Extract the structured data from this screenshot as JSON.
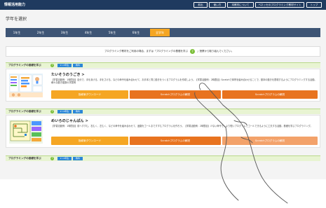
{
  "header": {
    "title": "情報活用能力",
    "buttons": [
      "前出",
      "使い方",
      "本教材について",
      "ベネッセのプログラミング教材サイト",
      "トップ"
    ]
  },
  "section_title": "学年を選択",
  "grades": [
    "1年生",
    "2年生",
    "3年生",
    "4年生",
    "5年生",
    "6年生",
    "全学年"
  ],
  "notice": {
    "text": "プログラミング教材をご利用の場合、まずは「プログラミングの基礎を学ぶ",
    "badge": "?",
    "text_after": "」授業から取り組んでください。"
  },
  "section_label": "プログラミングの基礎を学ぶ",
  "section_help": "?",
  "section_tags": [
    "1〜3年生",
    "教科"
  ],
  "cards": [
    {
      "title": "たいそうのうごき >",
      "desc": "【学習活動例：1時間目】自分で、手をあげる、手をさげる、などの命令を組み合わせて、お手本と同じ動きをつくるプログラムを作成しよう。【学習活動例：2時間目】Scratchで体育を組み合わせることで、基本の動きを表現するようにプログラミングする活動。様々な動き複数の学習例",
      "buttons": [
        "指導案ダウンロード",
        "Scratchプログラムの解説",
        "Scratchプログラムの解説"
      ]
    },
    {
      "title": "めいろのじゃんぱん >",
      "desc": "【学習活動例：1時間目】前へすすむ、右むく、左むく、などの命令を組み合わせて、迷路をゴールまですすむプログラムを作ろう。【学習活動例：2時間目】少ない命令で、より短いプログラムでゴールできるように工夫する活動。基礎を学ぶプログラミング。",
      "buttons": [
        "指導案ダウンロード",
        "Scratchプログラムの解説",
        "Scratchプログラムの解説"
      ]
    }
  ],
  "colors": {
    "header": "#1f3a5f",
    "grade_bar": "#3e5575",
    "active_grade": "#f5a623",
    "section_bg": "#e8f4d2",
    "tag_blue": "#2b86d6",
    "button_orange": "#e8731f"
  }
}
